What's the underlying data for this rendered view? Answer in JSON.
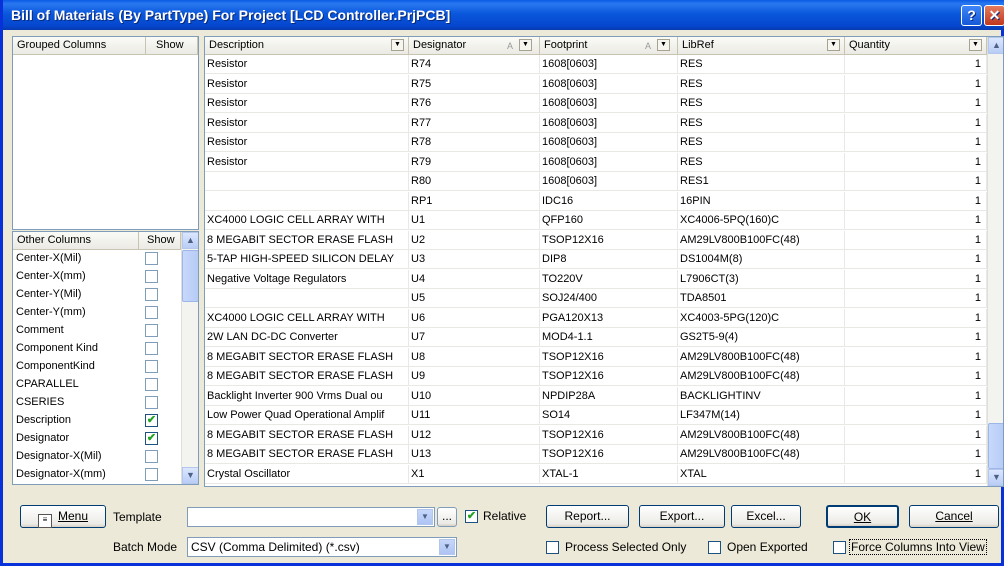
{
  "window": {
    "title": "Bill of Materials (By PartType) For Project [LCD Controller.PrjPCB]",
    "help_glyph": "?",
    "close_glyph": "✕"
  },
  "grouped_columns": {
    "header_name": "Grouped Columns",
    "header_show": "Show"
  },
  "other_columns": {
    "header_name": "Other Columns",
    "header_show": "Show",
    "items": [
      {
        "name": "Center-X(Mil)",
        "checked": false
      },
      {
        "name": "Center-X(mm)",
        "checked": false
      },
      {
        "name": "Center-Y(Mil)",
        "checked": false
      },
      {
        "name": "Center-Y(mm)",
        "checked": false
      },
      {
        "name": "Comment",
        "checked": false
      },
      {
        "name": "Component Kind",
        "checked": false
      },
      {
        "name": "ComponentKind",
        "checked": false
      },
      {
        "name": "CPARALLEL",
        "checked": false
      },
      {
        "name": "CSERIES",
        "checked": false
      },
      {
        "name": "Description",
        "checked": true
      },
      {
        "name": "Designator",
        "checked": true
      },
      {
        "name": "Designator-X(Mil)",
        "checked": false
      },
      {
        "name": "Designator-X(mm)",
        "checked": false
      }
    ]
  },
  "bom_table": {
    "columns": [
      "Description",
      "Designator",
      "Footprint",
      "LibRef",
      "Quantity"
    ],
    "rows": [
      [
        "Resistor",
        "R74",
        "1608[0603]",
        "RES",
        "1"
      ],
      [
        "Resistor",
        "R75",
        "1608[0603]",
        "RES",
        "1"
      ],
      [
        "Resistor",
        "R76",
        "1608[0603]",
        "RES",
        "1"
      ],
      [
        "Resistor",
        "R77",
        "1608[0603]",
        "RES",
        "1"
      ],
      [
        "Resistor",
        "R78",
        "1608[0603]",
        "RES",
        "1"
      ],
      [
        "Resistor",
        "R79",
        "1608[0603]",
        "RES",
        "1"
      ],
      [
        "",
        "R80",
        "1608[0603]",
        "RES1",
        "1"
      ],
      [
        "",
        "RP1",
        "IDC16",
        "16PIN",
        "1"
      ],
      [
        "XC4000 LOGIC CELL ARRAY WITH",
        "U1",
        "QFP160",
        "XC4006-5PQ(160)C",
        "1"
      ],
      [
        "8 MEGABIT SECTOR ERASE FLASH",
        "U2",
        "TSOP12X16",
        "AM29LV800B100FC(48)",
        "1"
      ],
      [
        "5-TAP HIGH-SPEED SILICON DELAY",
        "U3",
        "DIP8",
        "DS1004M(8)",
        "1"
      ],
      [
        "Negative Voltage Regulators",
        "U4",
        "TO220V",
        "L7906CT(3)",
        "1"
      ],
      [
        "",
        "U5",
        "SOJ24/400",
        "TDA8501",
        "1"
      ],
      [
        "XC4000 LOGIC CELL ARRAY WITH",
        "U6",
        "PGA120X13",
        "XC4003-5PG(120)C",
        "1"
      ],
      [
        "2W LAN DC-DC Converter",
        "U7",
        "MOD4-1.1",
        "GS2T5-9(4)",
        "1"
      ],
      [
        "8 MEGABIT SECTOR ERASE FLASH",
        "U8",
        "TSOP12X16",
        "AM29LV800B100FC(48)",
        "1"
      ],
      [
        "8 MEGABIT SECTOR ERASE FLASH",
        "U9",
        "TSOP12X16",
        "AM29LV800B100FC(48)",
        "1"
      ],
      [
        "Backlight Inverter 900 Vrms Dual ou",
        "U10",
        "NPDIP28A",
        "BACKLIGHTINV",
        "1"
      ],
      [
        "Low Power Quad Operational Amplif",
        "U11",
        "SO14",
        "LF347M(14)",
        "1"
      ],
      [
        "8 MEGABIT SECTOR ERASE FLASH",
        "U12",
        "TSOP12X16",
        "AM29LV800B100FC(48)",
        "1"
      ],
      [
        "8 MEGABIT SECTOR ERASE FLASH",
        "U13",
        "TSOP12X16",
        "AM29LV800B100FC(48)",
        "1"
      ],
      [
        "Crystal Oscillator",
        "X1",
        "XTAL-1",
        "XTAL",
        "1"
      ]
    ]
  },
  "bottom": {
    "menu_label": "Menu",
    "template_label": "Template",
    "template_value": "",
    "browse_label": "...",
    "relative_label": "Relative",
    "relative_checked": true,
    "report_label": "Report...",
    "export_label": "Export...",
    "excel_label": "Excel...",
    "ok_label": "OK",
    "cancel_label": "Cancel",
    "batch_mode_label": "Batch Mode",
    "batch_mode_value": "CSV (Comma Delimited) (*.csv)",
    "process_selected_label": "Process Selected Only",
    "process_selected_checked": false,
    "open_exported_label": "Open Exported",
    "open_exported_checked": false,
    "force_columns_label": "Force Columns Into View",
    "force_columns_checked": false
  },
  "icons": [
    "help-icon",
    "close-icon",
    "dropdown-arrow-icon",
    "sort-icon",
    "scroll-up-icon",
    "scroll-down-icon",
    "menu-icon",
    "checkmark-icon"
  ],
  "colors": {
    "titlebar": "#0a58dc",
    "check": "#21a121",
    "panel_border": "#7f9db9",
    "dialog_bg": "#ece9d8"
  }
}
